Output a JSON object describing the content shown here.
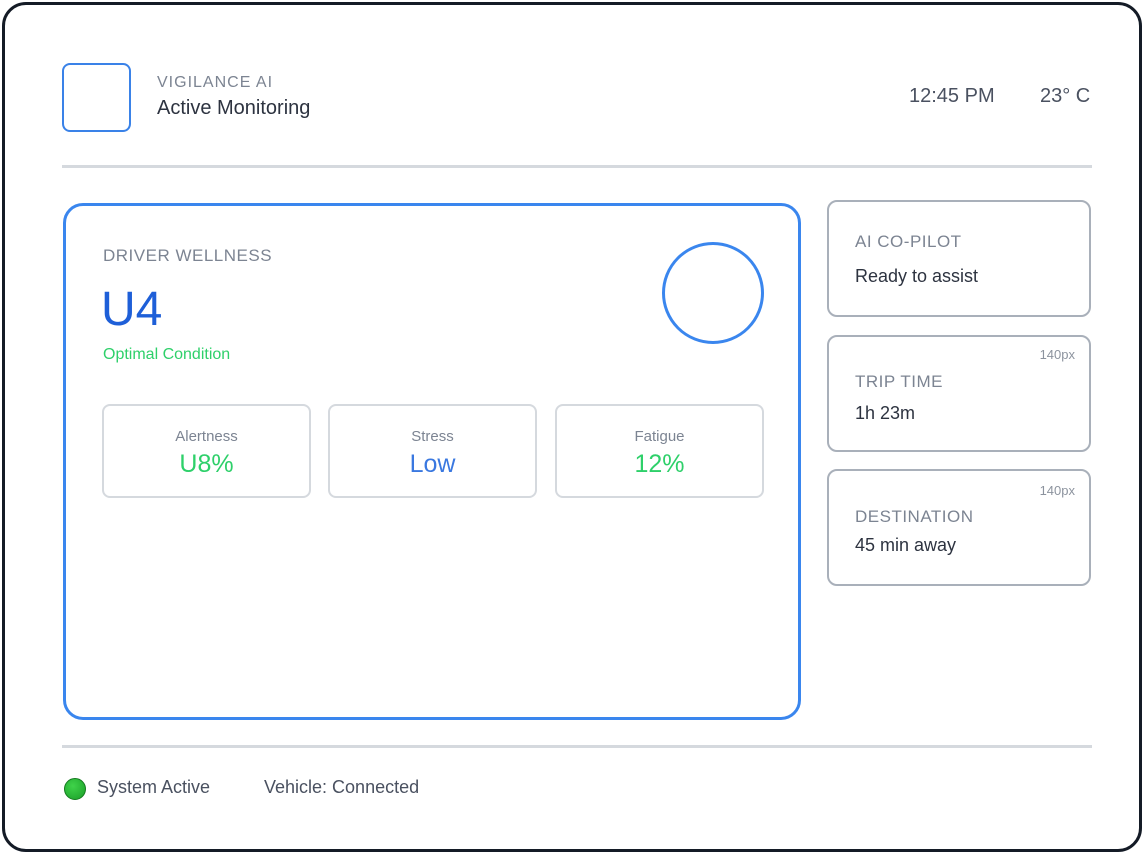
{
  "header": {
    "brand": "VIGILANCE AI",
    "subtitle": "Active Monitoring",
    "time": "12:45 PM",
    "temperature": "23° C"
  },
  "wellness": {
    "label": "DRIVER WELLNESS",
    "score": "U4",
    "condition": "Optimal Condition",
    "metrics": [
      {
        "label": "Alertness",
        "value": "U8%",
        "color": "#2ed06a"
      },
      {
        "label": "Stress",
        "value": "Low",
        "color": "#3a78e0"
      },
      {
        "label": "Fatigue",
        "value": "12%",
        "color": "#2ed06a"
      }
    ]
  },
  "side": {
    "copilot": {
      "label": "AI CO-PILOT",
      "value": "Ready to assist"
    },
    "trip": {
      "label": "TRIP TIME",
      "value": "1h 23m",
      "note": "140px"
    },
    "destination": {
      "label": "DESTINATION",
      "value": "45 min away",
      "note": "140px"
    }
  },
  "footer": {
    "status": "System Active",
    "vehicle": "Vehicle: Connected",
    "status_color": "#1fb52c"
  },
  "colors": {
    "accent": "#3a86ee",
    "success": "#2ed06a"
  }
}
